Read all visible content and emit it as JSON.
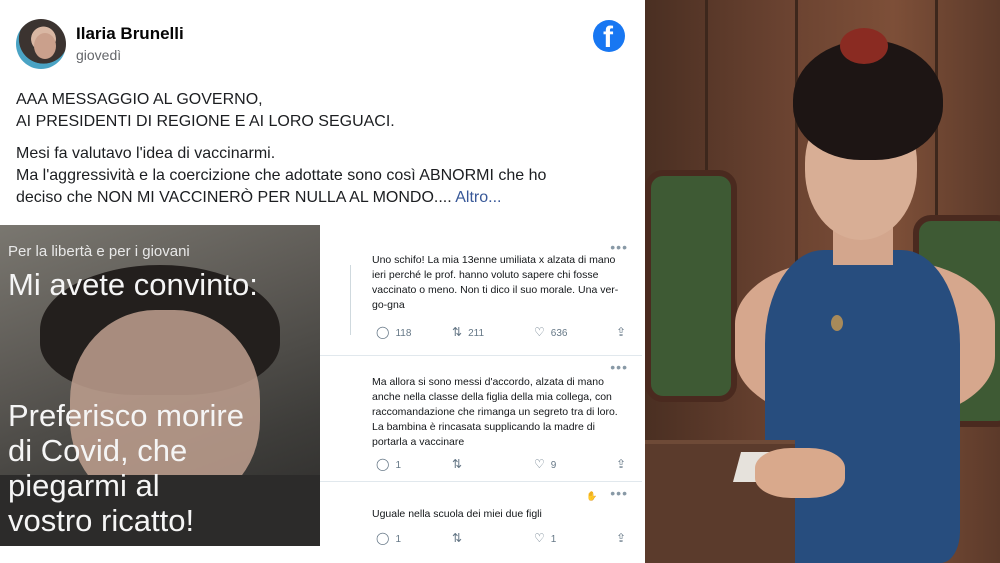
{
  "post": {
    "author": "Ilaria Brunelli",
    "date": "giovedì",
    "lines": [
      "AAA MESSAGGIO AL GOVERNO,",
      "AI PRESIDENTI DI REGIONE E AI LORO SEGUACI.",
      "Mesi fa valutavo l'idea di vaccinarmi.",
      "Ma l'aggressività e la coercizione che adottate sono così ABNORMI che ho",
      "deciso che NON MI VACCINERÒ PER NULLA AL MONDO...."
    ],
    "more_label": "Altro..."
  },
  "meme": {
    "top_text": "Per la libertà e per i giovani",
    "title": "Mi avete convinto:",
    "body_lines": [
      "Preferisco morire",
      "di Covid, che",
      "piegarmi al",
      "vostro ricatto!"
    ]
  },
  "tweets": [
    {
      "text": "Uno schifo! La mia 13enne umiliata x alzata di mano ieri perché le prof. hanno voluto sapere chi fosse vaccinato o meno. Non ti dico il suo morale. Una ver-go-gna",
      "replies": "118",
      "retweets": "211",
      "likes": "636"
    },
    {
      "text": "Ma allora si sono messi d'accordo, alzata di mano anche nella classe della figlia della mia collega, con raccomandazione che rimanga un segreto tra di loro. La bambina è rincasata supplicando la madre di portarla a vaccinare",
      "replies": "1",
      "retweets": "",
      "likes": "9"
    },
    {
      "text": "Uguale nella scuola dei miei due figli",
      "replies": "1",
      "retweets": "",
      "likes": "1"
    }
  ],
  "icons": {
    "facebook": "facebook-logo-icon",
    "reply": "reply-icon",
    "retweet": "retweet-icon",
    "like": "heart-icon",
    "share": "share-icon",
    "more": "more-dots-icon"
  },
  "colors": {
    "facebook_blue": "#1877f2",
    "link": "#385898",
    "secondary_text": "#65676b"
  }
}
